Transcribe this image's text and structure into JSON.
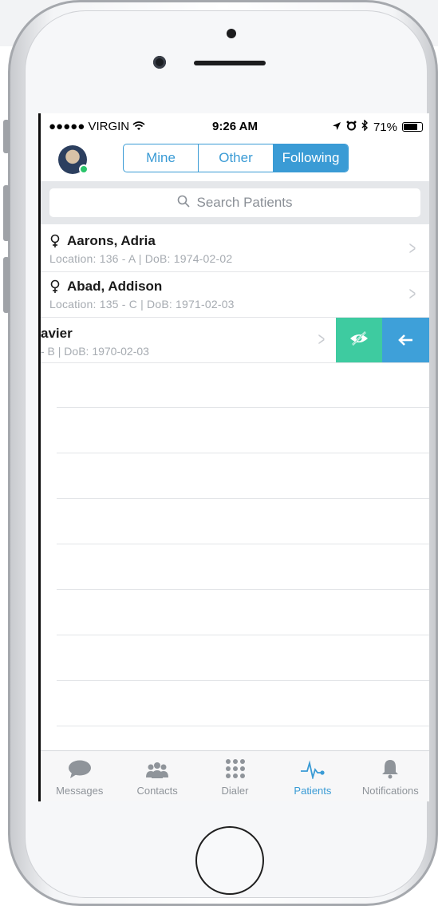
{
  "status_bar": {
    "carrier": "●●●●● VIRGIN",
    "time": "9:26 AM",
    "battery": "71%"
  },
  "segments": {
    "items": [
      "Mine",
      "Other",
      "Following"
    ],
    "active": "Following"
  },
  "search": {
    "placeholder": "Search Patients"
  },
  "patients": [
    {
      "name": "Aarons, Adria",
      "details": "Location: 136 - A | DoB: 1974-02-02"
    },
    {
      "name": "Abad, Addison",
      "details": "Location: 135 - C | DoB: 1971-02-03"
    }
  ],
  "swiped_patient": {
    "name": "avier",
    "details": "- B | DoB: 1970-02-03"
  },
  "tabs": [
    {
      "label": "Messages",
      "icon": "speech-bubble-icon"
    },
    {
      "label": "Contacts",
      "icon": "people-icon"
    },
    {
      "label": "Dialer",
      "icon": "keypad-icon"
    },
    {
      "label": "Patients",
      "icon": "heartbeat-icon",
      "active": true
    },
    {
      "label": "Notifications",
      "icon": "bell-icon"
    }
  ],
  "colors": {
    "accent": "#3a9bd5",
    "hide_action": "#3ecba0",
    "online": "#29c46a"
  }
}
